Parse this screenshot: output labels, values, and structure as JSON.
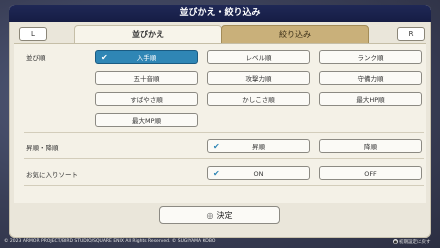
{
  "title": "並びかえ・絞り込み",
  "shoulder": {
    "left": "L",
    "right": "R"
  },
  "tabs": {
    "sort": "並びかえ",
    "filter": "絞り込み"
  },
  "sections": {
    "sort_order": {
      "label": "並び順",
      "options": [
        "入手順",
        "レベル順",
        "ランク順",
        "五十音順",
        "攻撃力順",
        "守備力順",
        "すばやさ順",
        "かしこさ順",
        "最大HP順",
        "最大MP順"
      ],
      "selected": "入手順"
    },
    "asc_desc": {
      "label": "昇順・降順",
      "options": [
        "昇順",
        "降順"
      ],
      "selected": "昇順"
    },
    "favorite_sort": {
      "label": "お気に入りソート",
      "options": [
        "ON",
        "OFF"
      ],
      "selected": "ON"
    }
  },
  "confirm": {
    "icon": "◎",
    "label": "決定"
  },
  "footer": {
    "copyright": "© 2023 ARMOR PROJECT/BIRD STUDIO/SQUARE ENIX All Rights Reserved. © SUGIYAMA KOBO",
    "reset_icon": "●",
    "reset_label": "初期設定に戻す"
  },
  "colors": {
    "selected": "#2f86b5",
    "title_bar": "#1f2856",
    "panel": "#eae6da"
  }
}
